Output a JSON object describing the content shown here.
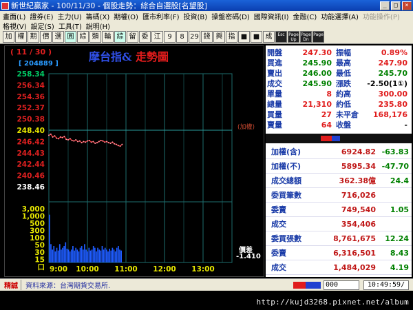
{
  "window": {
    "title": "新世紀贏家 - 100/11/30 - 個股走勢：綜合自選股[名望股]",
    "buttons": [
      "_",
      "□",
      "×"
    ]
  },
  "menu": {
    "row1": [
      "畫面(L)",
      "證券(E)",
      "主力(U)",
      "籌碼(X)",
      "期權(O)",
      "匯市利率(F)",
      "投資(B)",
      "操盤密碼(D)",
      "國際資訊(I)",
      "金融(C)",
      "功能選擇(A)",
      "功能操作(P)"
    ],
    "row1_disabled": [
      false,
      false,
      false,
      false,
      false,
      false,
      false,
      false,
      false,
      false,
      false,
      true
    ],
    "row2": [
      "格視(V)",
      "設定(S)",
      "工具(T)",
      "說明(H)"
    ]
  },
  "toolbar": {
    "buttons": [
      "加",
      "權",
      "期",
      "價",
      "選",
      "圓",
      "綜",
      "類",
      "輪",
      "綜",
      "留",
      "委",
      "江",
      "9",
      "8",
      "29",
      "錢",
      "興",
      "指",
      "■",
      "■",
      "成",
      "Esc",
      "Page Up",
      "Page Dn",
      "Page"
    ]
  },
  "chart": {
    "date": "( 11 / 30 )",
    "volume_total": "[ 204889 ]",
    "title_index": "摩台指&",
    "title_main": "走勢圖",
    "ref_note": "(加權)",
    "diff_label": "價差",
    "diff_value": "-1.410",
    "colors": {
      "price_line": "#e02020",
      "volume": "#1e5cff",
      "grid": "#1e6e6e",
      "ref_line": "#2a9d9d"
    }
  },
  "chart_data": {
    "type": "line",
    "title": "摩台指& 走勢圖",
    "y_ticks": [
      "258.34",
      "256.34",
      "254.36",
      "252.37",
      "250.38",
      "248.40",
      "246.42",
      "244.43",
      "242.44",
      "240.46",
      "238.46"
    ],
    "ylim": [
      238.46,
      258.34
    ],
    "reference": 248.4,
    "x_ticks": [
      "9:00",
      "10:00",
      "11:00",
      "12:00",
      "13:00"
    ],
    "x_minutes": [
      0,
      60,
      120,
      180,
      240,
      285
    ],
    "series": [
      {
        "x": [
          0,
          3,
          6,
          9,
          12,
          15,
          18,
          21,
          24,
          27,
          30,
          33,
          36,
          39,
          42,
          45,
          48,
          51,
          54,
          57,
          60,
          63,
          66,
          69,
          72,
          75,
          78,
          81,
          84,
          87,
          90,
          93,
          96,
          99,
          102,
          105,
          108,
          111,
          114
        ],
        "y": [
          247.5,
          247.7,
          247.2,
          247.4,
          247.0,
          246.9,
          247.2,
          247.1,
          247.3,
          246.8,
          246.7,
          246.9,
          246.6,
          246.5,
          246.7,
          246.4,
          246.5,
          246.2,
          246.4,
          246.3,
          246.5,
          246.6,
          246.3,
          246.4,
          246.1,
          246.2,
          246.4,
          246.6,
          246.5,
          246.3,
          246.4,
          246.2,
          246.1,
          246.3,
          246.0,
          245.9,
          245.7,
          245.6,
          245.9
        ]
      }
    ],
    "volume": {
      "ylim": [
        0,
        3000
      ],
      "y_ticks": [
        "3,000",
        "1,000",
        "500",
        "300",
        "100",
        "50",
        "30",
        "15",
        "口"
      ],
      "values": [
        2600,
        1000,
        700,
        900,
        600,
        800,
        650,
        1000,
        700,
        800,
        900,
        1100,
        750,
        700,
        600,
        700,
        900,
        650,
        800,
        700,
        600,
        800,
        900,
        700,
        1000,
        700,
        600,
        800,
        650,
        700,
        900,
        800,
        600,
        800,
        700,
        650,
        900,
        700,
        800,
        700,
        600,
        750,
        650,
        800,
        700,
        600,
        800,
        900,
        700,
        650
      ]
    }
  },
  "quote": {
    "rows": [
      {
        "l1": "開盤",
        "v1": "247.30",
        "c1": "up",
        "l2": "振幅",
        "v2": "0.89%",
        "c2": "up"
      },
      {
        "l1": "買進",
        "v1": "245.90",
        "c1": "down",
        "l2": "最高",
        "v2": "247.90",
        "c2": "up"
      },
      {
        "l1": "賣出",
        "v1": "246.00",
        "c1": "down",
        "l2": "最低",
        "v2": "245.70",
        "c2": "down"
      },
      {
        "l1": "成交",
        "v1": "245.90",
        "c1": "down",
        "l2": "漲跌",
        "v2": "-2.50(1①)",
        "c2": "flat"
      },
      {
        "l1": "單量",
        "v1": "8",
        "c1": "up",
        "l2": "約高",
        "v2": "300.00",
        "c2": "up"
      },
      {
        "l1": "總量",
        "v1": "21,310",
        "c1": "up",
        "l2": "約低",
        "v2": "235.80",
        "c2": "up"
      },
      {
        "l1": "買量",
        "v1": "27",
        "c1": "up",
        "l2": "未平倉",
        "v2": "168,176",
        "c2": "up"
      },
      {
        "l1": "賣量",
        "v1": "64",
        "c1": "up",
        "l2": "收盤",
        "v2": "-",
        "c2": "flat"
      }
    ]
  },
  "index": {
    "rows": [
      {
        "label": "加權(含)",
        "value": "6924.82",
        "change": "-63.83",
        "dir": "down"
      },
      {
        "label": "加權(不)",
        "value": "5895.34",
        "change": "-47.70",
        "dir": "down"
      },
      {
        "label": "成交總額",
        "value": "362.38億",
        "change": "24.4",
        "dir": "down"
      },
      {
        "label": "委買筆數",
        "value": "716,026",
        "change": "",
        "dir": "down"
      },
      {
        "label": "委賣",
        "value": "749,540",
        "change": "1.05",
        "dir": "down"
      },
      {
        "label": "成交",
        "value": "354,406",
        "change": "",
        "dir": "down"
      },
      {
        "label": "委買張數",
        "value": "8,761,675",
        "change": "12.24",
        "dir": "down"
      },
      {
        "label": "委賣",
        "value": "6,316,501",
        "change": "8.43",
        "dir": "down"
      },
      {
        "label": "成交",
        "value": "1,484,029",
        "change": "4.19",
        "dir": "down"
      }
    ]
  },
  "status": {
    "badge": "精誠",
    "source": "資料來源：台灣期貨交易所.",
    "input": "000",
    "clock": "10:49:59/"
  },
  "footer": {
    "watermark": "http://kujd3268.pixnet.net/album"
  }
}
